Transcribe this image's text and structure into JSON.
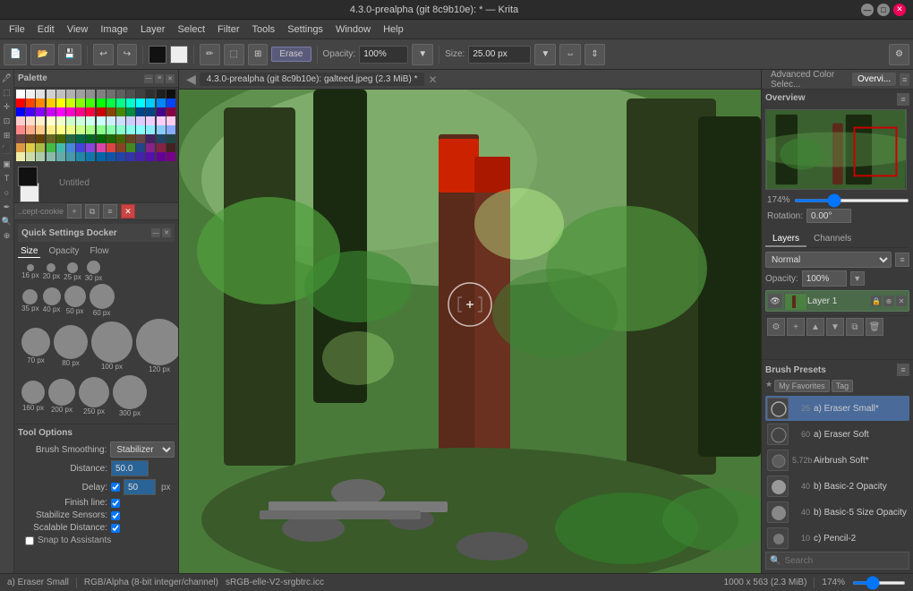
{
  "titlebar": {
    "title": "4.3.0-prealpha (git 8c9b10e): * — Krita"
  },
  "menubar": {
    "items": [
      "File",
      "Edit",
      "View",
      "Image",
      "Layer",
      "Select",
      "Filter",
      "Tools",
      "Settings",
      "Window",
      "Help"
    ]
  },
  "toolbar": {
    "opacity_label": "Opacity:",
    "opacity_value": "100%",
    "size_label": "Size:",
    "size_value": "25.00 px",
    "erase_label": "Erase"
  },
  "canvas_tab": {
    "title": "4.3.0-prealpha (git 8c9b10e): galteed.jpeg (2.3 MiB) *"
  },
  "palette": {
    "title": "Palette"
  },
  "layer_name": {
    "prefix": "..cept-cookie",
    "untitled": "Untitled"
  },
  "quick_settings": {
    "title": "Quick Settings Docker",
    "tabs": [
      "Size",
      "Opacity",
      "Flow"
    ],
    "brushes": [
      {
        "size": 8,
        "label": "16 px"
      },
      {
        "size": 10,
        "label": "20 px"
      },
      {
        "size": 12,
        "label": "25 px"
      },
      {
        "size": 15,
        "label": "30 px"
      },
      {
        "size": 17,
        "label": "35 px"
      },
      {
        "size": 20,
        "label": "40 px"
      },
      {
        "size": 24,
        "label": "50 px"
      },
      {
        "size": 28,
        "label": "60 px"
      },
      {
        "size": 32,
        "label": "70 px"
      },
      {
        "size": 38,
        "label": "80 px"
      },
      {
        "size": 46,
        "label": "100 px"
      },
      {
        "size": 52,
        "label": "120 px"
      },
      {
        "size": 60,
        "label": "160 px"
      },
      {
        "size": 66,
        "label": "200 px"
      },
      {
        "size": 72,
        "label": "250 px"
      },
      {
        "size": 78,
        "label": "300 px"
      }
    ]
  },
  "tool_options": {
    "title": "Tool Options",
    "brush_smoothing_label": "Brush Smoothing:",
    "brush_smoothing_value": "Stabilizer",
    "distance_label": "Distance:",
    "distance_value": "50.0",
    "delay_label": "Delay:",
    "delay_value": "50",
    "delay_unit": "px",
    "finish_line_label": "Finish line:",
    "stabilize_sensors_label": "Stabilize Sensors:",
    "scalable_distance_label": "Scalable Distance:",
    "snap_assistants_label": "Snap to Assistants"
  },
  "right_panel": {
    "tabs": [
      "Advanced Color Selec...",
      "Overvi..."
    ],
    "active_tab": "Overvi..."
  },
  "overview": {
    "title": "Overview",
    "zoom_value": "174%",
    "rotation_label": "Rotation:",
    "rotation_value": "0.00°"
  },
  "layers": {
    "tabs": [
      "Layers",
      "Channels"
    ],
    "active_tab": "Layers",
    "blend_mode": "Normal",
    "opacity_label": "Opacity:",
    "opacity_value": "100%",
    "items": [
      {
        "name": "Layer 1",
        "num": "1"
      }
    ]
  },
  "brush_presets": {
    "title": "Brush Presets",
    "filter_label": "My Favorites",
    "tag_label": "Tag",
    "search_placeholder": "Search",
    "presets": [
      {
        "num": "25",
        "name": "a) Eraser Small*",
        "active": true
      },
      {
        "num": "60",
        "name": "a) Eraser Soft"
      },
      {
        "num": "5.72b",
        "name": "Airbrush Soft*"
      },
      {
        "num": "40",
        "name": "b) Basic-2 Opacity"
      },
      {
        "num": "40",
        "name": "b) Basic-5 Size Opacity"
      },
      {
        "num": "10",
        "name": "c) Pencil-2"
      }
    ]
  },
  "statusbar": {
    "layer_name": "a) Eraser Small",
    "color_mode": "RGB/Alpha (8-bit integer/channel)",
    "color_profile": "sRGB-elle-V2-srgbtrc.icc",
    "dimensions": "1000 x 563 (2.3 MiB)",
    "zoom": "174%"
  },
  "colors": {
    "palette_colors": [
      "#ffffff",
      "#f0f0f0",
      "#e0e0e0",
      "#d0d0d0",
      "#c0c0c0",
      "#b0b0b0",
      "#a0a0a0",
      "#909090",
      "#808080",
      "#707070",
      "#606060",
      "#505050",
      "#404040",
      "#303030",
      "#202020",
      "#101010",
      "#ff0000",
      "#ff4400",
      "#ff8800",
      "#ffcc00",
      "#ffff00",
      "#ccff00",
      "#88ff00",
      "#44ff00",
      "#00ff00",
      "#00ff44",
      "#00ff88",
      "#00ffcc",
      "#00ffff",
      "#00ccff",
      "#0088ff",
      "#0044ff",
      "#0000ff",
      "#4400ff",
      "#8800ff",
      "#cc00ff",
      "#ff00ff",
      "#ff00cc",
      "#ff0088",
      "#ff0044",
      "#cc0000",
      "#884400",
      "#448800",
      "#008844",
      "#004488",
      "#004484",
      "#440088",
      "#880044",
      "#ffcccc",
      "#ffddcc",
      "#ffeecc",
      "#ffffcc",
      "#eeffcc",
      "#ccffcc",
      "#ccffdd",
      "#ccffee",
      "#ccffff",
      "#cceeff",
      "#ccddff",
      "#ccccff",
      "#ddccff",
      "#eeccff",
      "#ffccff",
      "#ffccee",
      "#ff8888",
      "#ffaa88",
      "#ffcc88",
      "#ffee88",
      "#ffff88",
      "#eeff88",
      "#ccff88",
      "#aaff88",
      "#88ff88",
      "#88ffaa",
      "#88ffcc",
      "#88ffee",
      "#88ffff",
      "#88eeff",
      "#88ccff",
      "#88aaff",
      "#664444",
      "#664422",
      "#664400",
      "#666622",
      "#446600",
      "#226644",
      "#006644",
      "#006622",
      "#006600",
      "#226600",
      "#446600",
      "#664422",
      "#664444",
      "#442266",
      "#224466",
      "#224444",
      "#dd9944",
      "#ddcc44",
      "#aabb44",
      "#44bb44",
      "#44bbaa",
      "#4488dd",
      "#4444dd",
      "#8844dd",
      "#dd44aa",
      "#dd4444",
      "#884422",
      "#448822",
      "#224488",
      "#882288",
      "#882244",
      "#442222",
      "#eeeeaa",
      "#ccddaa",
      "#aaccaa",
      "#88bbaa",
      "#66aaaa",
      "#4499aa",
      "#2288aa",
      "#1177aa",
      "#0066aa",
      "#1155aa",
      "#2244aa",
      "#3333aa",
      "#4422aa",
      "#5511aa",
      "#660099",
      "#770088"
    ]
  }
}
